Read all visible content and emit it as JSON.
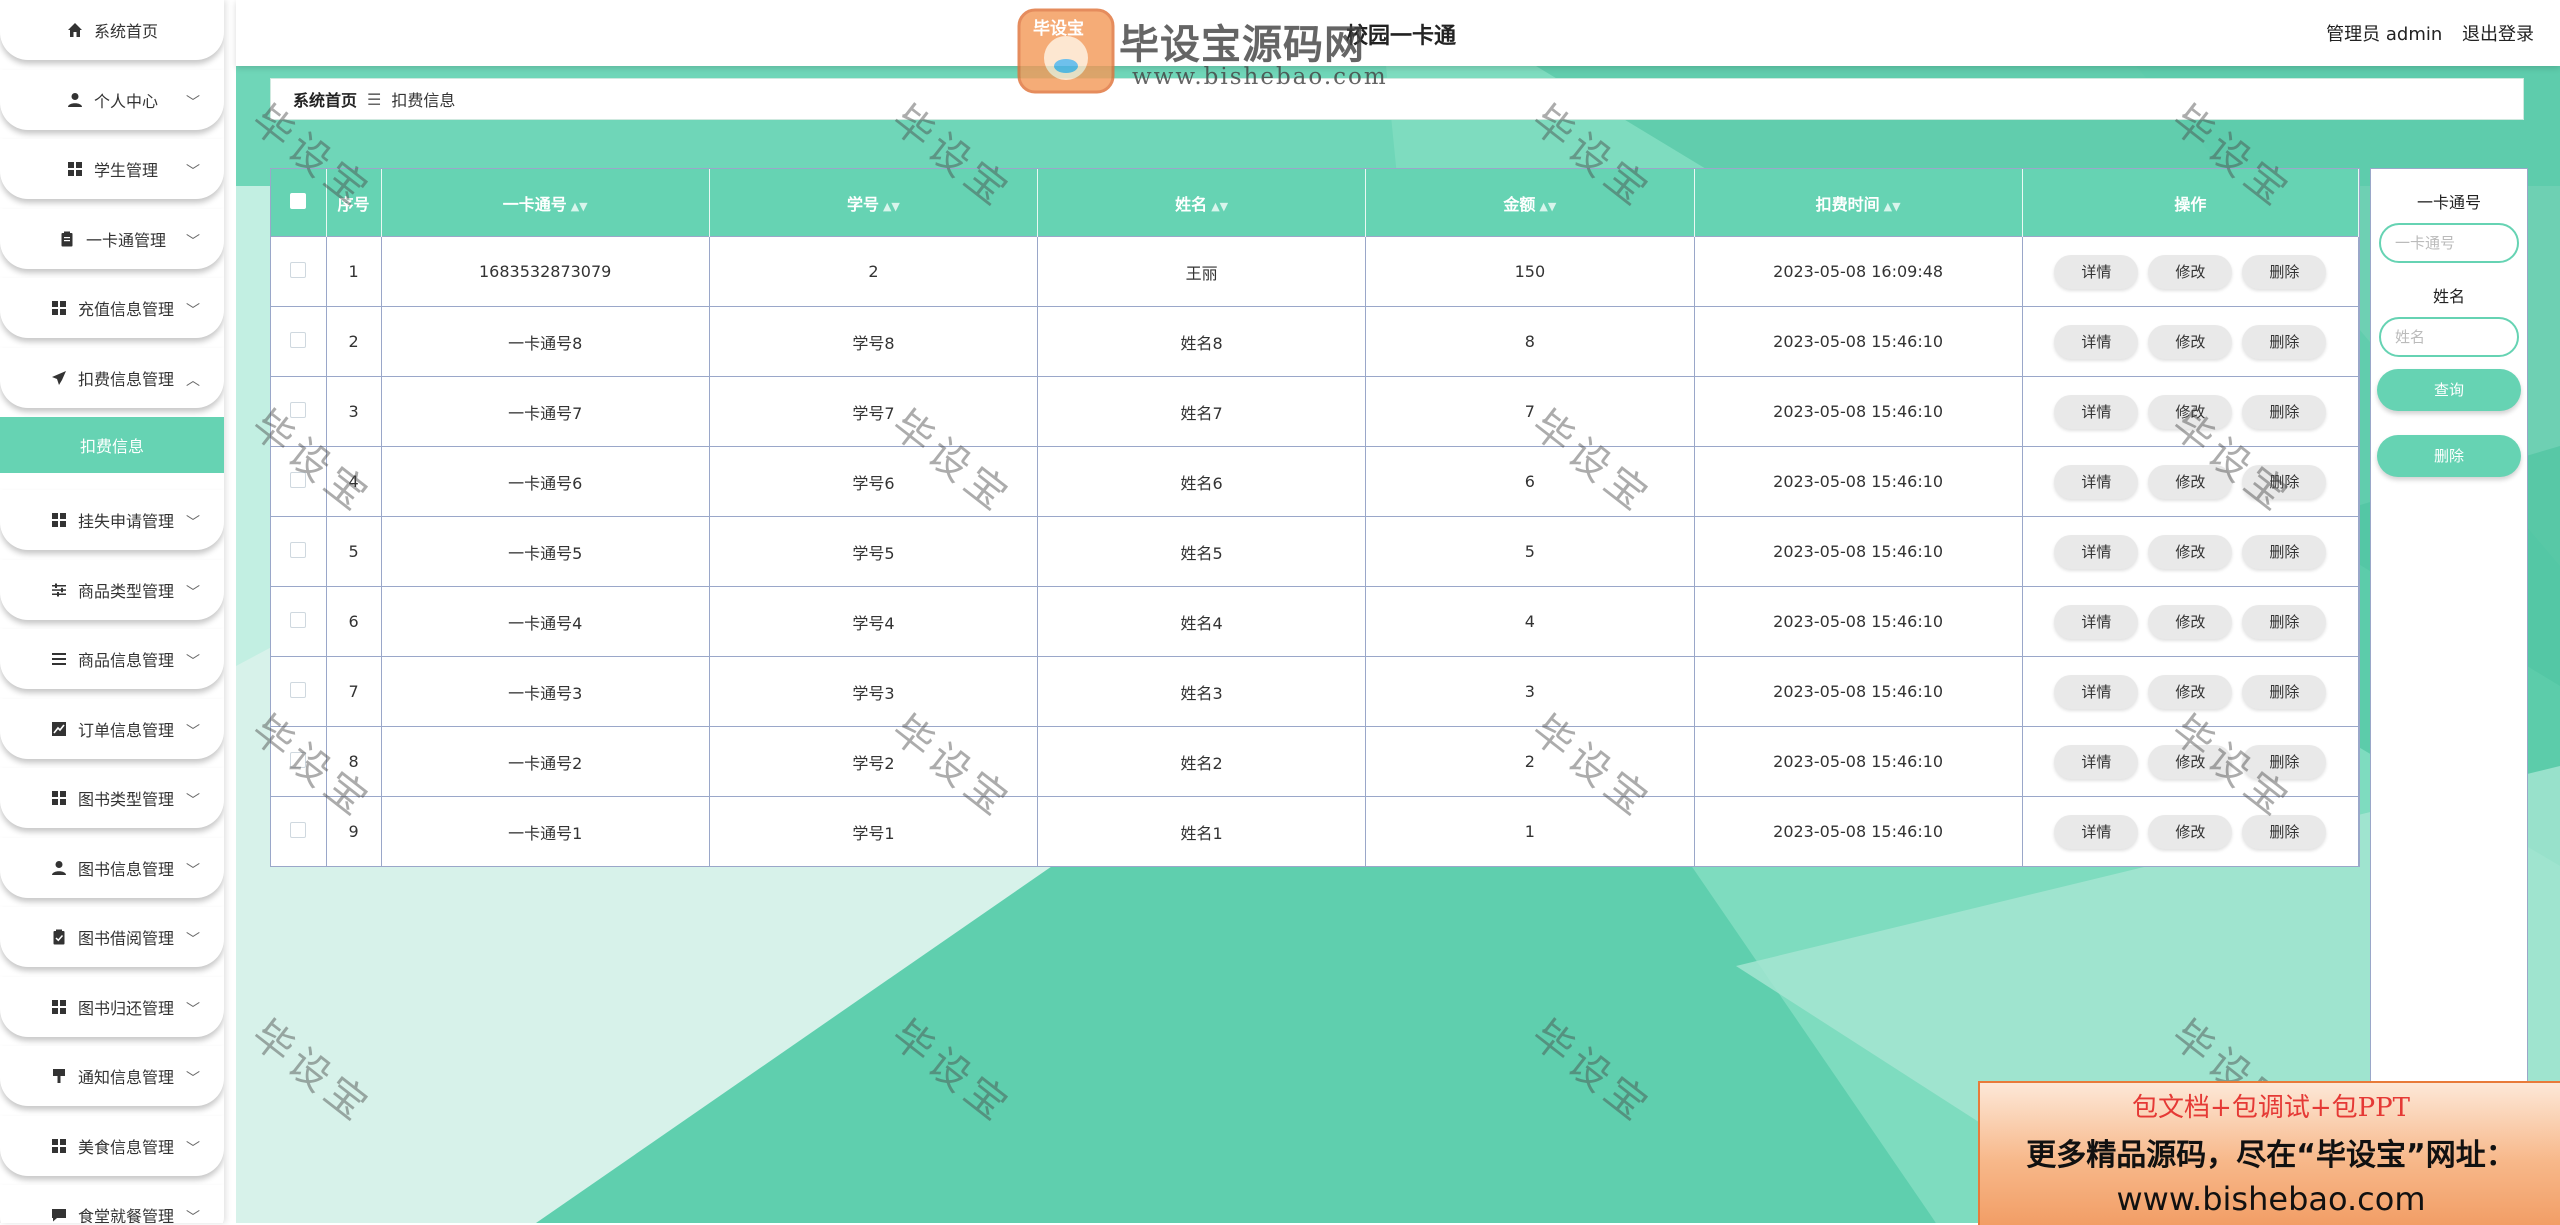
{
  "app": {
    "title": "校园一卡通"
  },
  "user": {
    "role_label": "管理员 admin",
    "logout_label": "退出登录"
  },
  "sidebar": {
    "items": [
      {
        "label": "系统首页",
        "icon": "home-icon"
      },
      {
        "label": "个人中心",
        "icon": "user-icon"
      },
      {
        "label": "学生管理",
        "icon": "grid-icon"
      },
      {
        "label": "一卡通管理",
        "icon": "clipboard-icon"
      },
      {
        "label": "充值信息管理",
        "icon": "grid-icon"
      },
      {
        "label": "扣费信息管理",
        "icon": "send-icon"
      },
      {
        "label": "挂失申请管理",
        "icon": "grid-icon"
      },
      {
        "label": "商品类型管理",
        "icon": "sliders-icon"
      },
      {
        "label": "商品信息管理",
        "icon": "list-icon"
      },
      {
        "label": "订单信息管理",
        "icon": "chart-icon"
      },
      {
        "label": "图书类型管理",
        "icon": "grid-icon"
      },
      {
        "label": "图书信息管理",
        "icon": "user-icon"
      },
      {
        "label": "图书借阅管理",
        "icon": "clipboard-check-icon"
      },
      {
        "label": "图书归还管理",
        "icon": "grid-icon"
      },
      {
        "label": "通知信息管理",
        "icon": "pin-icon"
      },
      {
        "label": "美食信息管理",
        "icon": "grid-icon"
      },
      {
        "label": "食堂就餐管理",
        "icon": "chat-icon"
      }
    ],
    "active_sub": "扣费信息"
  },
  "breadcrumb": {
    "home": "系统首页",
    "separator": "☰",
    "current": "扣费信息"
  },
  "table": {
    "headers": {
      "index": "序号",
      "card_no": "一卡通号",
      "student_no": "学号",
      "name": "姓名",
      "amount": "金额",
      "time": "扣费时间",
      "ops": "操作"
    },
    "sort_glyph": "▲▼",
    "rows": [
      {
        "index": "1",
        "card_no": "1683532873079",
        "student_no": "2",
        "name": "王丽",
        "amount": "150",
        "time": "2023-05-08 16:09:48"
      },
      {
        "index": "2",
        "card_no": "一卡通号8",
        "student_no": "学号8",
        "name": "姓名8",
        "amount": "8",
        "time": "2023-05-08 15:46:10"
      },
      {
        "index": "3",
        "card_no": "一卡通号7",
        "student_no": "学号7",
        "name": "姓名7",
        "amount": "7",
        "time": "2023-05-08 15:46:10"
      },
      {
        "index": "4",
        "card_no": "一卡通号6",
        "student_no": "学号6",
        "name": "姓名6",
        "amount": "6",
        "time": "2023-05-08 15:46:10"
      },
      {
        "index": "5",
        "card_no": "一卡通号5",
        "student_no": "学号5",
        "name": "姓名5",
        "amount": "5",
        "time": "2023-05-08 15:46:10"
      },
      {
        "index": "6",
        "card_no": "一卡通号4",
        "student_no": "学号4",
        "name": "姓名4",
        "amount": "4",
        "time": "2023-05-08 15:46:10"
      },
      {
        "index": "7",
        "card_no": "一卡通号3",
        "student_no": "学号3",
        "name": "姓名3",
        "amount": "3",
        "time": "2023-05-08 15:46:10"
      },
      {
        "index": "8",
        "card_no": "一卡通号2",
        "student_no": "学号2",
        "name": "姓名2",
        "amount": "2",
        "time": "2023-05-08 15:46:10"
      },
      {
        "index": "9",
        "card_no": "一卡通号1",
        "student_no": "学号1",
        "name": "姓名1",
        "amount": "1",
        "time": "2023-05-08 15:46:10"
      }
    ],
    "op_labels": {
      "detail": "详情",
      "edit": "修改",
      "delete": "删除"
    }
  },
  "search": {
    "card_label": "一卡通号",
    "card_placeholder": "一卡通号",
    "name_label": "姓名",
    "name_placeholder": "姓名",
    "query_label": "查询",
    "delete_label": "删除"
  },
  "watermark": {
    "logo_badge": "毕设宝",
    "logo_title": "毕设宝源码网",
    "logo_url": "www.bishebao.com",
    "stamp": "毕设宝",
    "promo_line1": "包文档+包调试+包PPT",
    "promo_line2": "更多精品源码，尽在“毕设宝”网址：",
    "promo_line3": "www.bishebao.com"
  },
  "colors": {
    "accent": "#66d3b3",
    "border": "#9aa7c9",
    "button_gray": "#e9e9e9"
  }
}
